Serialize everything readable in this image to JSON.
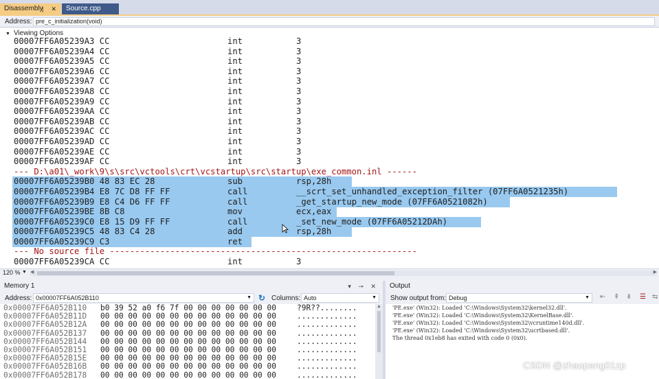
{
  "tabs": [
    {
      "label": "Disassembly",
      "active": true,
      "icons": "❘ ✕"
    },
    {
      "label": "Source.cpp",
      "active": false
    }
  ],
  "address_bar": {
    "label": "Address:",
    "value": "pre_c_initialization(void)"
  },
  "viewing_options": "Viewing Options",
  "disassembly": {
    "pre_rows": [
      {
        "addr": "00007FF6A05239A3 CC",
        "mnemonic": "int",
        "operand": "3"
      },
      {
        "addr": "00007FF6A05239A4 CC",
        "mnemonic": "int",
        "operand": "3"
      },
      {
        "addr": "00007FF6A05239A5 CC",
        "mnemonic": "int",
        "operand": "3"
      },
      {
        "addr": "00007FF6A05239A6 CC",
        "mnemonic": "int",
        "operand": "3"
      },
      {
        "addr": "00007FF6A05239A7 CC",
        "mnemonic": "int",
        "operand": "3"
      },
      {
        "addr": "00007FF6A05239A8 CC",
        "mnemonic": "int",
        "operand": "3"
      },
      {
        "addr": "00007FF6A05239A9 CC",
        "mnemonic": "int",
        "operand": "3"
      },
      {
        "addr": "00007FF6A05239AA CC",
        "mnemonic": "int",
        "operand": "3"
      },
      {
        "addr": "00007FF6A05239AB CC",
        "mnemonic": "int",
        "operand": "3"
      },
      {
        "addr": "00007FF6A05239AC CC",
        "mnemonic": "int",
        "operand": "3"
      },
      {
        "addr": "00007FF6A05239AD CC",
        "mnemonic": "int",
        "operand": "3"
      },
      {
        "addr": "00007FF6A05239AE CC",
        "mnemonic": "int",
        "operand": "3"
      },
      {
        "addr": "00007FF6A05239AF CC",
        "mnemonic": "int",
        "operand": "3"
      }
    ],
    "source_line": "--- D:\\a01\\_work\\9\\s\\src\\vctools\\crt\\vcstartup\\src\\startup\\exe_common.inl ------",
    "selected_rows": [
      {
        "addr": "00007FF6A05239B0 48 83 EC 28",
        "mnemonic": "sub",
        "operand": "rsp,28h"
      },
      {
        "addr": "00007FF6A05239B4 E8 7C D8 FF FF",
        "mnemonic": "call",
        "operand": "__scrt_set_unhandled_exception_filter (07FF6A0521235h)"
      },
      {
        "addr": "00007FF6A05239B9 E8 C4 D6 FF FF",
        "mnemonic": "call",
        "operand": "_get_startup_new_mode (07FF6A0521082h)"
      },
      {
        "addr": "00007FF6A05239BE 8B C8",
        "mnemonic": "mov",
        "operand": "ecx,eax"
      },
      {
        "addr": "00007FF6A05239C0 E8 15 D9 FF FF",
        "mnemonic": "call",
        "operand": "_set_new_mode (07FF6A05212DAh)"
      },
      {
        "addr": "00007FF6A05239C5 48 83 C4 28",
        "mnemonic": "add",
        "operand": "rsp,28h"
      },
      {
        "addr": "00007FF6A05239C9 C3",
        "mnemonic": "ret",
        "operand": ""
      }
    ],
    "no_source_line": "--- No source file -------------------------------------------------------------",
    "post_rows": [
      {
        "addr": "00007FF6A05239CA CC",
        "mnemonic": "int",
        "operand": "3"
      }
    ]
  },
  "zoom": "120 %",
  "memory": {
    "title": "Memory 1",
    "address_label": "Address:",
    "address_value": "0x00007FF6A052B110",
    "columns_label": "Columns:",
    "columns_value": "Auto",
    "rows": [
      {
        "addr": "0x00007FF6A052B110",
        "hex": "b0 39 52 a0 f6 7f 00 00 00 00 00 00 00",
        "ascii": "?9R??........"
      },
      {
        "addr": "0x00007FF6A052B11D",
        "hex": "00 00 00 00 00 00 00 00 00 00 00 00 00",
        "ascii": "............."
      },
      {
        "addr": "0x00007FF6A052B12A",
        "hex": "00 00 00 00 00 00 00 00 00 00 00 00 00",
        "ascii": "............."
      },
      {
        "addr": "0x00007FF6A052B137",
        "hex": "00 00 00 00 00 00 00 00 00 00 00 00 00",
        "ascii": "............."
      },
      {
        "addr": "0x00007FF6A052B144",
        "hex": "00 00 00 00 00 00 00 00 00 00 00 00 00",
        "ascii": "............."
      },
      {
        "addr": "0x00007FF6A052B151",
        "hex": "00 00 00 00 00 00 00 00 00 00 00 00 00",
        "ascii": "............."
      },
      {
        "addr": "0x00007FF6A052B15E",
        "hex": "00 00 00 00 00 00 00 00 00 00 00 00 00",
        "ascii": "............."
      },
      {
        "addr": "0x00007FF6A052B16B",
        "hex": "00 00 00 00 00 00 00 00 00 00 00 00 00",
        "ascii": "............."
      },
      {
        "addr": "0x00007FF6A052B178",
        "hex": "00 00 00 00 00 00 00 00 00 00 00 00 00",
        "ascii": "............."
      }
    ]
  },
  "output": {
    "title": "Output",
    "show_from_label": "Show output from:",
    "show_from_value": "Debug",
    "lines": [
      "'PE.exe' (Win32): Loaded 'C:\\Windows\\System32\\kernel32.dll'.",
      "'PE.exe' (Win32): Loaded 'C:\\Windows\\System32\\KernelBase.dll'.",
      "'PE.exe' (Win32): Loaded 'C:\\Windows\\System32\\vcruntime140d.dll'.",
      "'PE.exe' (Win32): Loaded 'C:\\Windows\\System32\\ucrtbased.dll'.",
      "The thread 0x1eb8 has exited with code 0 (0x0)."
    ]
  },
  "watermark": "CSDN @zhaopeng01zp",
  "colors": {
    "selection": "#99c9ef",
    "tab_active": "#f5cc84",
    "tab_inactive": "#3f5a8a",
    "source_text": "#a31515"
  }
}
